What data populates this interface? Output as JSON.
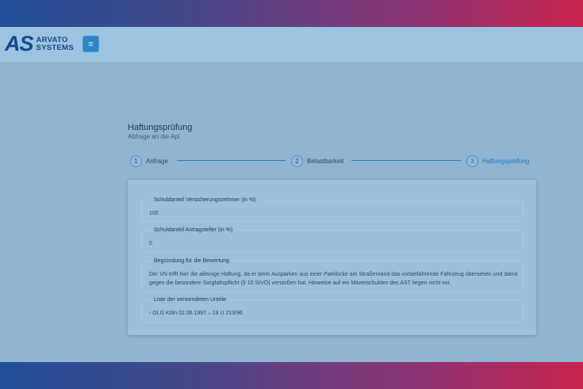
{
  "brand": {
    "logo_mark": "AS",
    "logo_line1": "ARVATO",
    "logo_line2": "SYSTEMS"
  },
  "header": {
    "menu_icon": "hamburger-menu-icon",
    "menu_glyph": "≡"
  },
  "page": {
    "title": "Haftungsprüfung",
    "subtitle": "Abfrage an die Api"
  },
  "stepper": {
    "steps": [
      {
        "number": "1",
        "label": "Anfrage"
      },
      {
        "number": "2",
        "label": "Belastbarkeit"
      },
      {
        "number": "3",
        "label": "Haftungsprüfung"
      }
    ],
    "active_step": 3
  },
  "form": {
    "fields": [
      {
        "legend": "Schuldanteil Versicherungsnehmer (in %)",
        "value": "100"
      },
      {
        "legend": "Schuldanteil Antragsteller (in %)",
        "value": "0"
      },
      {
        "legend": "Begründung für die Bewertung",
        "value_line1": "Der VN trifft hier die alleinige Haftung, da er beim Ausparken aus einer Parklücke am Straßenrand das vorbeifahrende Fahrzeug übersehen und damit",
        "value_line2": "gegen die besondere Sorgfaltspflicht (§ 10 StVO) verstoßen hat. Hinweise auf ein Mitverschulden des AST liegen nicht vor."
      },
      {
        "legend": "Liste der verwendeten Urteile",
        "value": "- OLG Köln 02.06.1997 – 19 U 213/96"
      }
    ]
  },
  "colors": {
    "brand_blue": "#15498f",
    "accent": "#1f78c1",
    "gradient_start": "#1e4f98",
    "gradient_end": "#c8234e"
  }
}
